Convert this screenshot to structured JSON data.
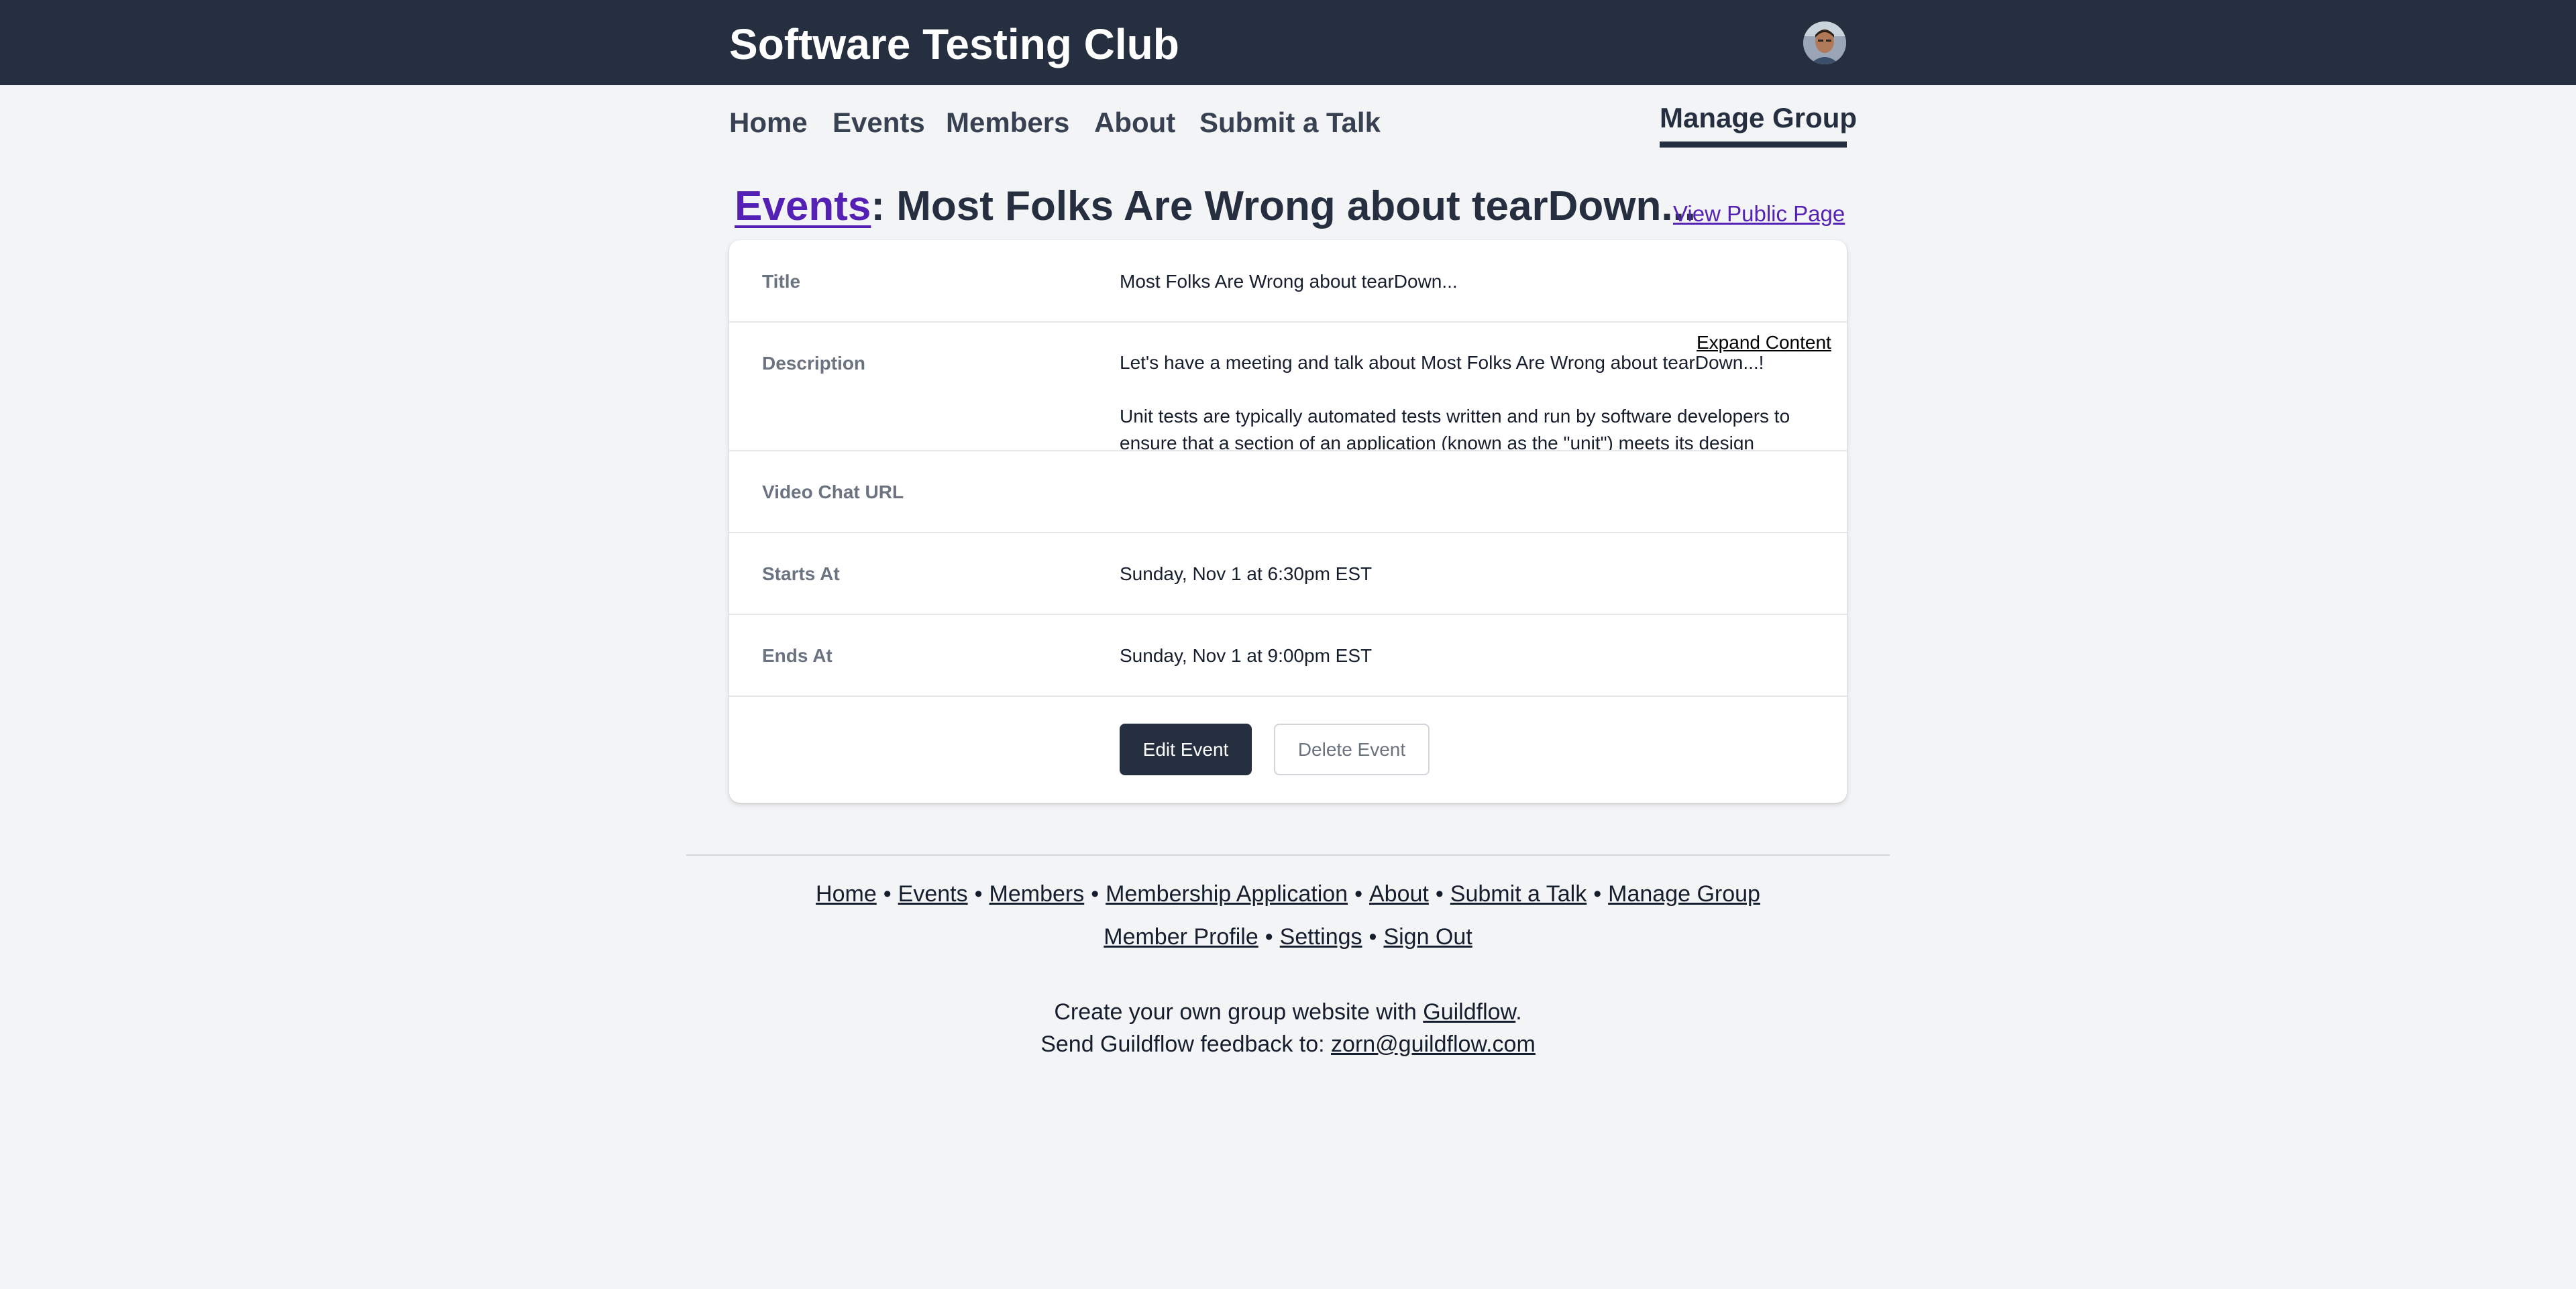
{
  "header": {
    "site_title": "Software Testing Club",
    "avatar_alt": "User avatar"
  },
  "nav": {
    "items": [
      {
        "label": "Home"
      },
      {
        "label": "Events"
      },
      {
        "label": "Members"
      },
      {
        "label": "About"
      },
      {
        "label": "Submit a Talk"
      }
    ],
    "manage_group": "Manage Group"
  },
  "page": {
    "breadcrumb_link": "Events",
    "title_suffix": ": Most Folks Are Wrong about tearDown...",
    "view_public_page": "View Public Page"
  },
  "event": {
    "title_label": "Title",
    "title_value": "Most Folks Are Wrong about tearDown...",
    "description_label": "Description",
    "description_paragraphs": [
      "Let's have a meeting and talk about Most Folks Are Wrong about tearDown...!",
      "Unit tests are typically automated tests written and run by software developers to ensure that a section of an application (known as the \"unit\") meets its design"
    ],
    "expand_content": "Expand Content",
    "video_chat_label": "Video Chat URL",
    "video_chat_value": "",
    "starts_label": "Starts At",
    "starts_value": "Sunday, Nov 1 at 6:30pm EST",
    "ends_label": "Ends At",
    "ends_value": "Sunday, Nov 1 at 9:00pm EST",
    "edit_button": "Edit Event",
    "delete_button": "Delete Event"
  },
  "footer": {
    "line1": [
      "Home",
      "Events",
      "Members",
      "Membership Application",
      "About",
      "Submit a Talk",
      "Manage Group"
    ],
    "line2": [
      "Member Profile",
      "Settings",
      "Sign Out"
    ],
    "separator": "•",
    "credit_prefix": "Create your own group website with ",
    "credit_link": "Guildflow",
    "credit_suffix": ".",
    "feedback_prefix": "Send Guildflow feedback to: ",
    "feedback_email": "zorn@guildflow.com"
  },
  "colors": {
    "header_bg": "#252f3f",
    "page_bg": "#f3f4f6",
    "link_purple": "#5521b5",
    "button_dark": "#252f3f"
  }
}
